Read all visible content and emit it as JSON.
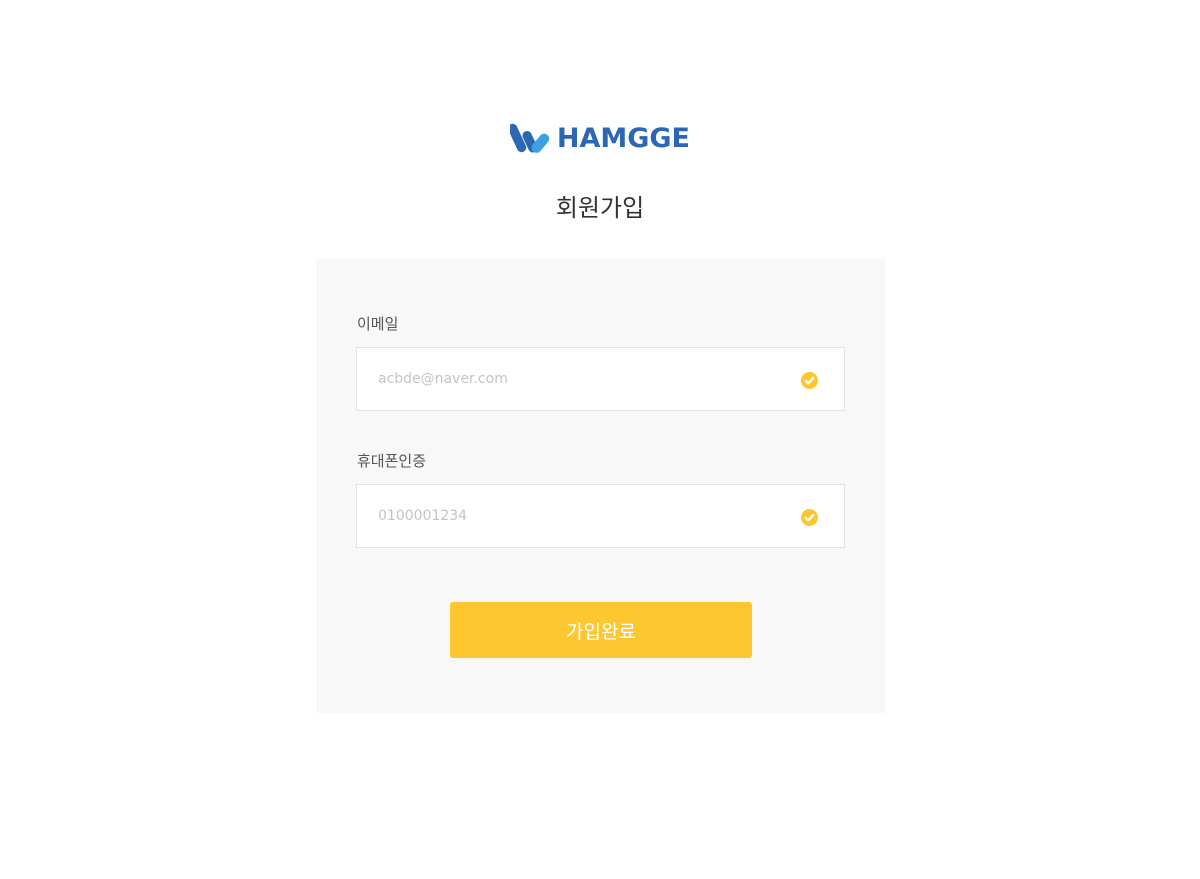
{
  "brand": {
    "logo_text": "HAMGGE",
    "colors": {
      "logo_dark": "#2c67b5",
      "logo_light": "#3ca1e0"
    }
  },
  "page": {
    "title": "회원가입"
  },
  "form": {
    "email": {
      "label": "이메일",
      "placeholder": "acbde@naver.com",
      "status_icon": "check-circle-icon"
    },
    "phone": {
      "label": "휴대폰인증",
      "placeholder": "0100001234",
      "status_icon": "check-circle-icon"
    },
    "submit_label": "가입완료"
  },
  "colors": {
    "accent": "#fec62f",
    "card_background": "#f8f8f8",
    "text": "#333333"
  }
}
